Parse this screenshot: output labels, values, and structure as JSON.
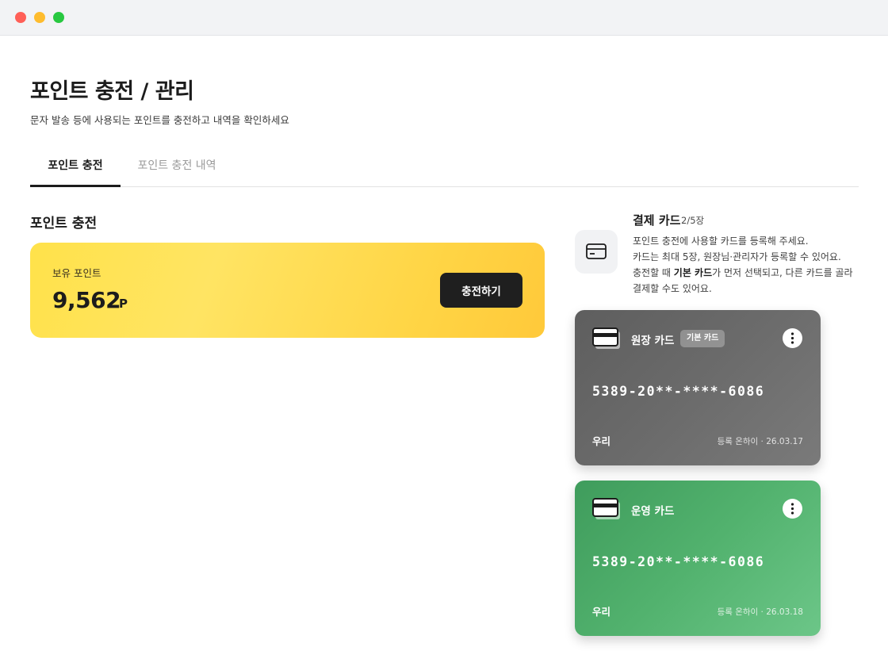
{
  "window": {
    "controls": [
      "close",
      "minimize",
      "maximize"
    ]
  },
  "page": {
    "title": "포인트 충전 / 관리",
    "subtitle": "문자 발송 등에 사용되는 포인트를 충전하고 내역을 확인하세요"
  },
  "tabs": [
    {
      "label": "포인트 충전",
      "active": true
    },
    {
      "label": "포인트 충전 내역",
      "active": false
    }
  ],
  "charge": {
    "section_title": "포인트 충전",
    "balance_label": "보유 포인트",
    "balance_value": "9,562",
    "balance_unit": "P",
    "charge_button": "충전하기",
    "card_color": "#ffdf4a"
  },
  "payment": {
    "title": "결제 카드",
    "count": "2/5장",
    "icon": "credit-card-icon",
    "desc_line1": "포인트 충전에 사용할 카드를 등록해 주세요.",
    "desc_line2": "카드는 최대 5장, 원장님·관리자가 등록할 수 있어요.",
    "desc_line3_pre": "충전할 때 ",
    "desc_line3_bold": "기본 카드",
    "desc_line3_post": "가 먼저 선택되고, 다른 카드를 골라",
    "desc_line4": "결제할 수도 있어요.",
    "cards": [
      {
        "name": "원장 카드",
        "badge": "기본 카드",
        "number": "5389-20**-****-6086",
        "bank": "우리",
        "meta": "등록 온하이 · 26.03.17",
        "color": "#6b6b6b"
      },
      {
        "name": "운영 카드",
        "number": "5389-20**-****-6086",
        "bank": "우리",
        "meta": "등록 온하이 · 26.03.18",
        "color": "#52b26e"
      }
    ]
  }
}
